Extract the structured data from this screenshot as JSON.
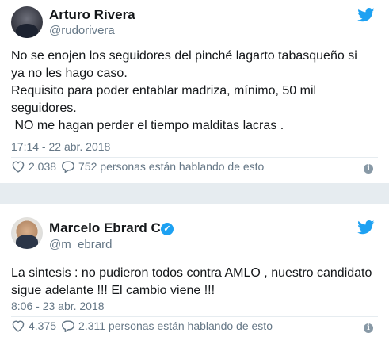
{
  "colors": {
    "twitter_blue": "#1da1f2",
    "secondary_text": "#657786",
    "primary_text": "#14171a",
    "separator": "#e6ecf0"
  },
  "tweets": [
    {
      "name": "Arturo Rivera",
      "handle": "@rudorivera",
      "verified": false,
      "text": "No se enojen los seguidores del pinché lagarto tabasqueño si\nya no les hago caso.\nRequisito para poder entablar madriza, mínimo, 50 mil\nseguidores.\n NO me hagan perder el tiempo malditas lacras .",
      "timestamp": "17:14 - 22 abr. 2018",
      "likes": "2.038",
      "conversation": "752 personas están hablando de esto",
      "icons": {
        "like": "heart-icon",
        "reply": "speech-bubble-icon",
        "info": "info-icon",
        "brand": "twitter-bird-icon"
      }
    },
    {
      "name": "Marcelo Ebrard C.",
      "handle": "@m_ebrard",
      "verified": true,
      "text": "La sintesis : no pudieron todos contra AMLO , nuestro candidato\nsigue adelante !!! El cambio viene !!!",
      "timestamp": "8:06 - 23 abr. 2018",
      "likes": "4.375",
      "conversation": "2.311 personas están hablando de esto",
      "icons": {
        "like": "heart-icon",
        "reply": "speech-bubble-icon",
        "info": "info-icon",
        "brand": "twitter-bird-icon"
      }
    }
  ]
}
